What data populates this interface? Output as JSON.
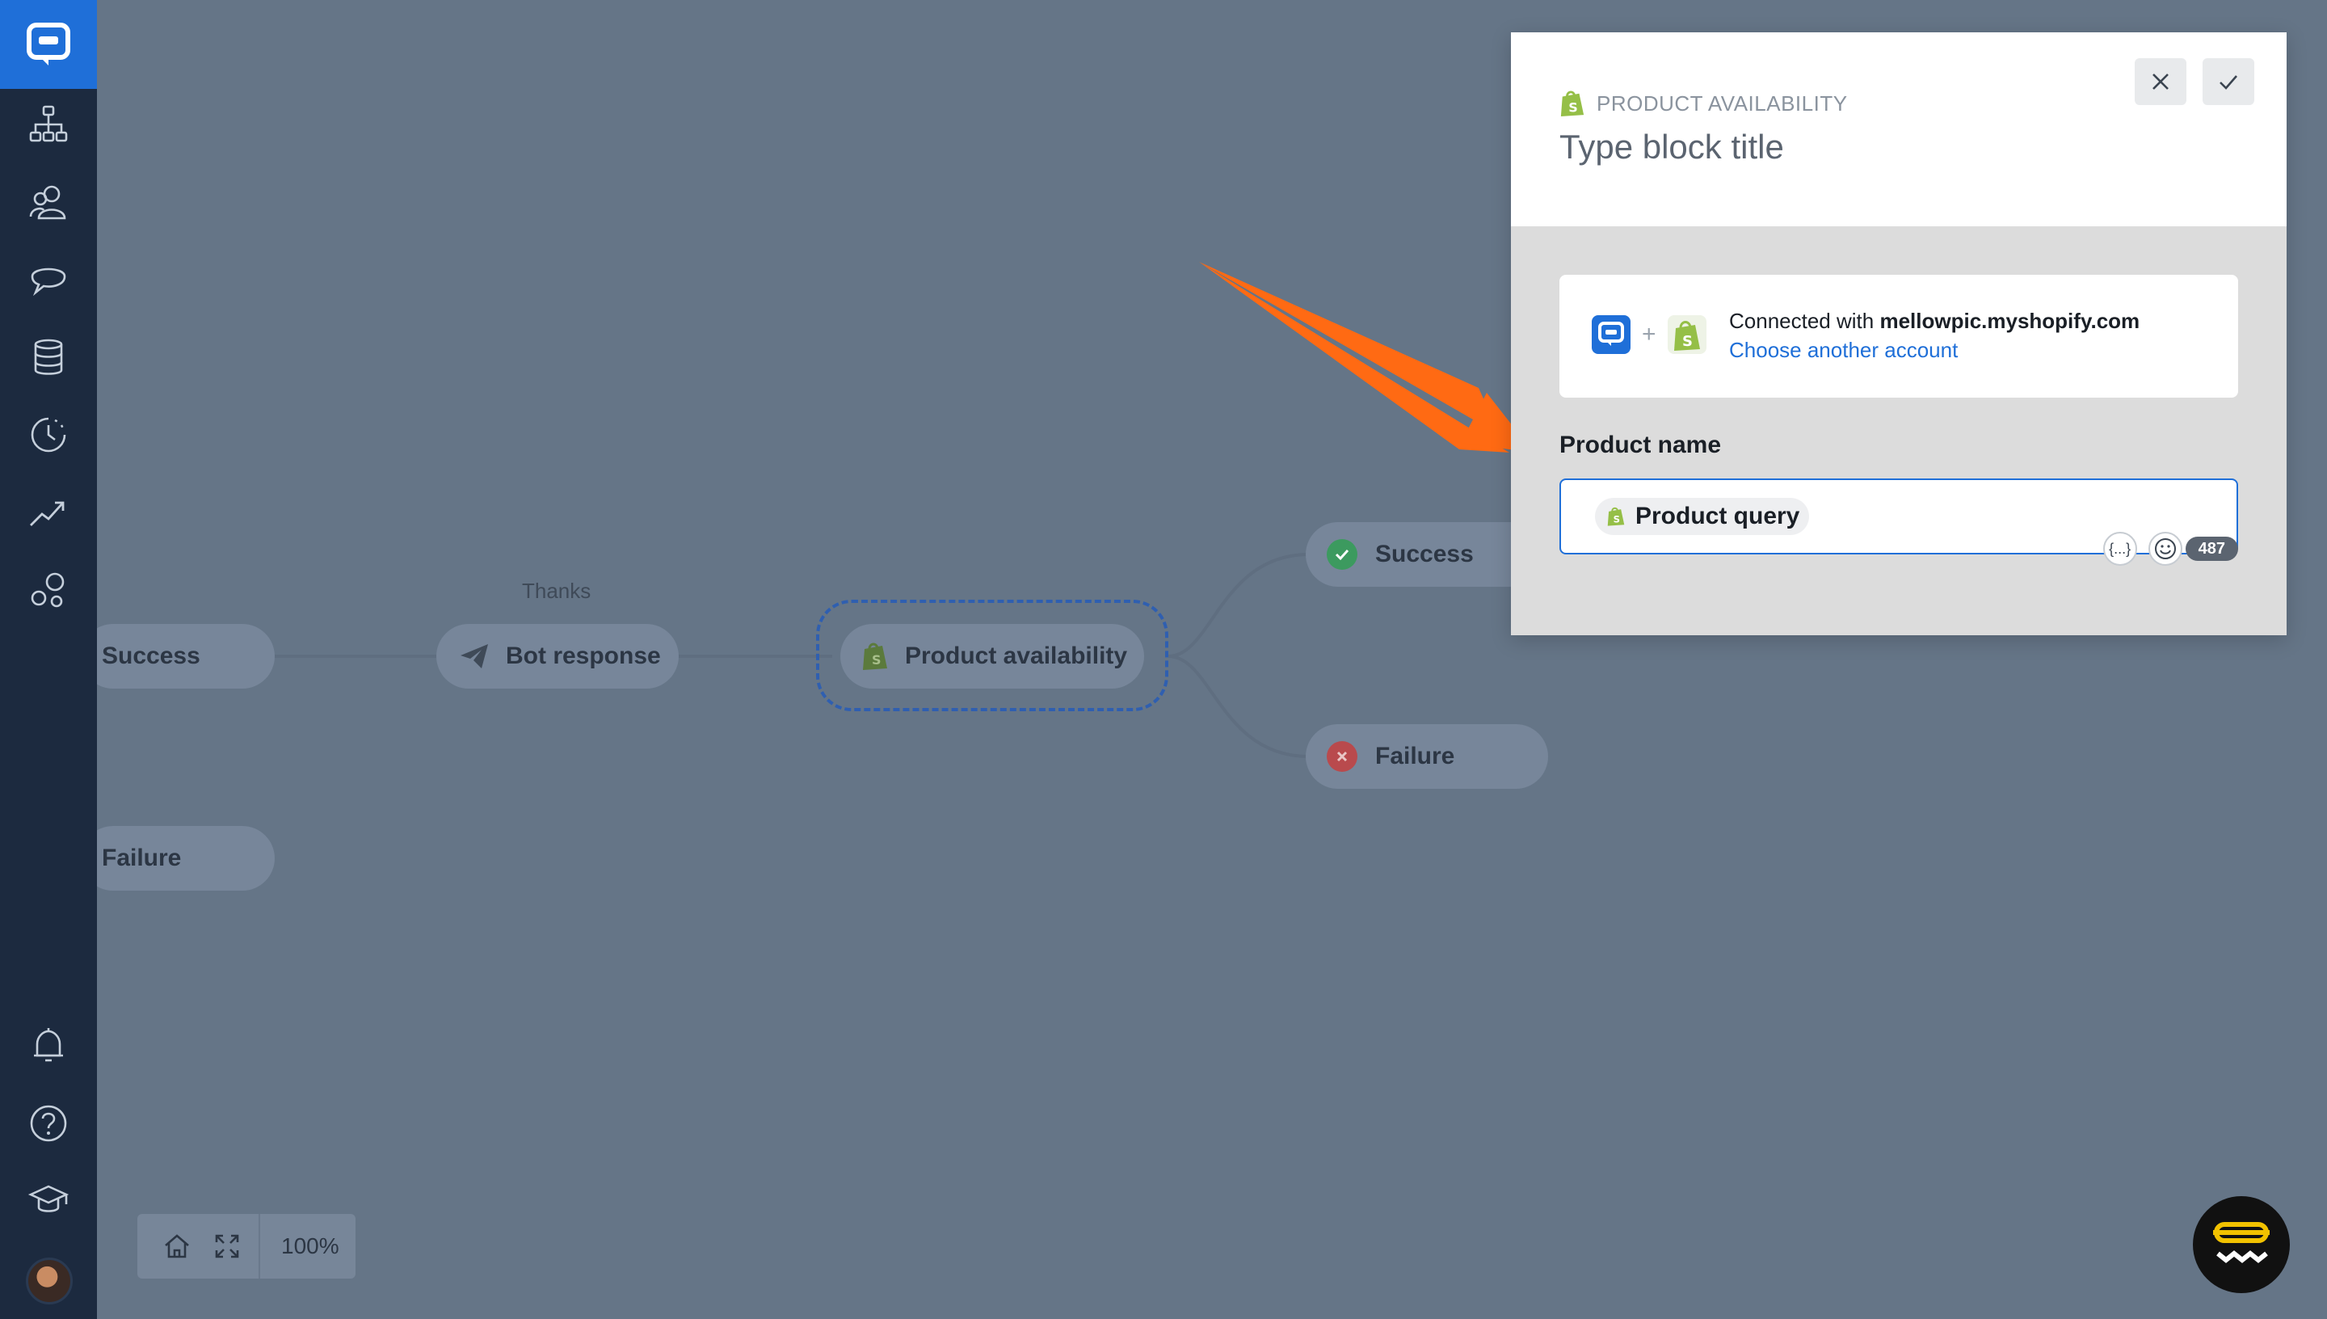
{
  "sidebar": {
    "items": [
      {
        "name": "flows-icon"
      },
      {
        "name": "users-icon"
      },
      {
        "name": "chat-icon"
      },
      {
        "name": "database-icon"
      },
      {
        "name": "history-icon"
      },
      {
        "name": "reports-icon"
      },
      {
        "name": "integrations-icon"
      }
    ],
    "bottom_items": [
      {
        "name": "bell-icon"
      },
      {
        "name": "help-icon"
      },
      {
        "name": "academy-icon"
      }
    ]
  },
  "canvas": {
    "left_nodes": {
      "success": "Success",
      "failure": "Failure"
    },
    "bot_response": {
      "caption": "Thanks",
      "label": "Bot response"
    },
    "product_availability": {
      "label": "Product availability"
    },
    "right_nodes": {
      "success": "Success",
      "failure": "Failure"
    }
  },
  "zoom": {
    "level": "100%"
  },
  "panel": {
    "tag": "PRODUCT AVAILABILITY",
    "title_placeholder": "Type block title",
    "connection": {
      "prefix": "Connected with ",
      "account": "mellowpic.myshopify.com",
      "plus": "+",
      "link": "Choose another account"
    },
    "field": {
      "label": "Product name",
      "chip": "Product query",
      "variables_label": "{...}",
      "char_count": "487"
    }
  },
  "colors": {
    "accent": "#1f6fd8",
    "sidebar": "#1c2a3f",
    "canvas": "#657587",
    "success": "#3c9a5f",
    "failure": "#d64545",
    "shopify": "#95bf47",
    "arrow": "#ff6a13"
  }
}
